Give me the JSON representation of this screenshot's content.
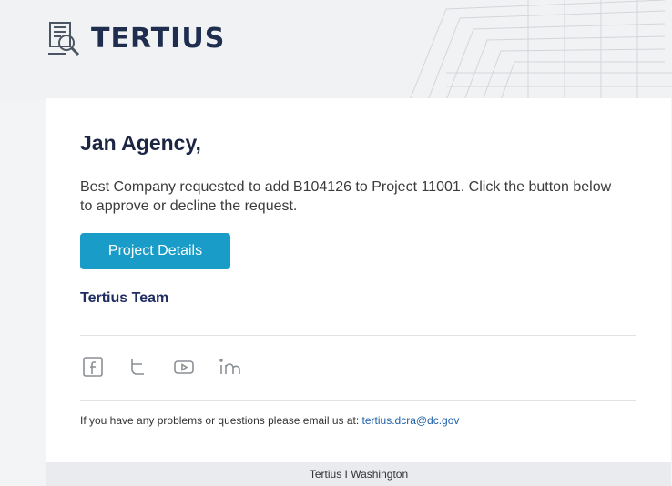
{
  "brand": {
    "name": "TERTIUS",
    "color": "#1f2d4e"
  },
  "email": {
    "greeting": "Jan Agency,",
    "message": "Best Company requested to add B104126 to Project 11001. Click the button below to approve or decline the request.",
    "button_label": "Project Details",
    "button_color": "#1a9cc9",
    "signature": "Tertius Team"
  },
  "social": [
    "facebook-icon",
    "twitter-icon",
    "youtube-icon",
    "linkedin-icon"
  ],
  "footer": {
    "prompt": "If you have any problems or questions please email us at: ",
    "email": "tertius.dcra@dc.gov",
    "bottom": "Tertius I Washington"
  }
}
